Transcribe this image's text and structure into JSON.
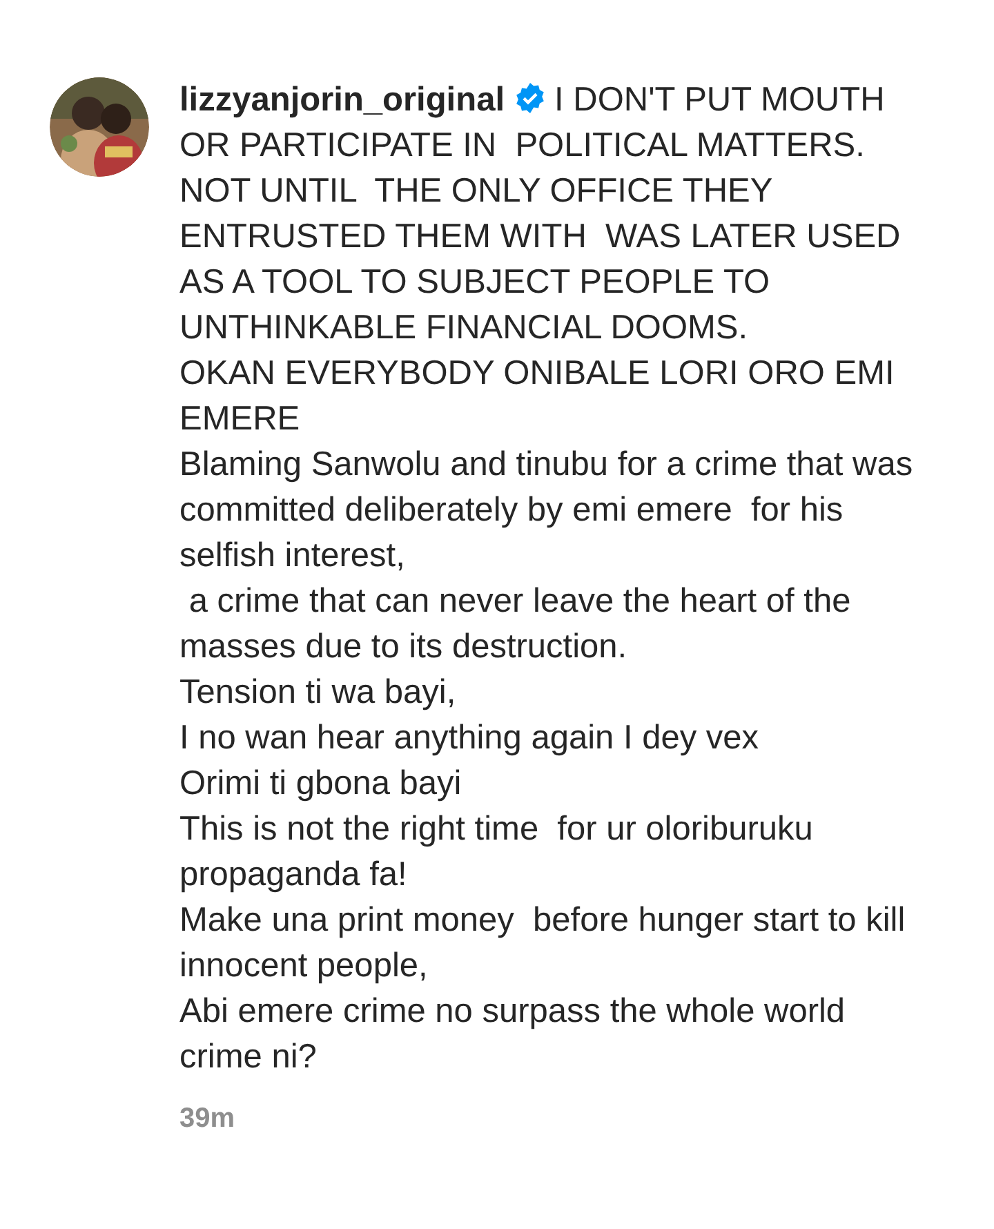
{
  "comment": {
    "username": "lizzyanjorin_original",
    "verified": true,
    "paragraphs": [
      "I DON'T PUT MOUTH OR PARTICIPATE IN  POLITICAL MATTERS. NOT UNTIL  THE ONLY OFFICE THEY ENTRUSTED THEM WITH  WAS LATER USED AS A TOOL TO SUBJECT PEOPLE TO UNTHINKABLE FINANCIAL DOOMS.",
      "OKAN EVERYBODY ONIBALE LORI ORO EMI EMERE",
      "Blaming Sanwolu and tinubu for a crime that was committed deliberately by emi emere  for his selfish interest,",
      " a crime that can never leave the heart of the masses due to its destruction.",
      "Tension ti wa bayi,",
      "I no wan hear anything again I dey vex",
      "Orimi ti gbona bayi",
      "This is not the right time  for ur oloriburuku propaganda fa!",
      "Make una print money  before hunger start to kill innocent people,",
      "Abi emere crime no surpass the whole world crime ni?"
    ],
    "time": "39m"
  }
}
